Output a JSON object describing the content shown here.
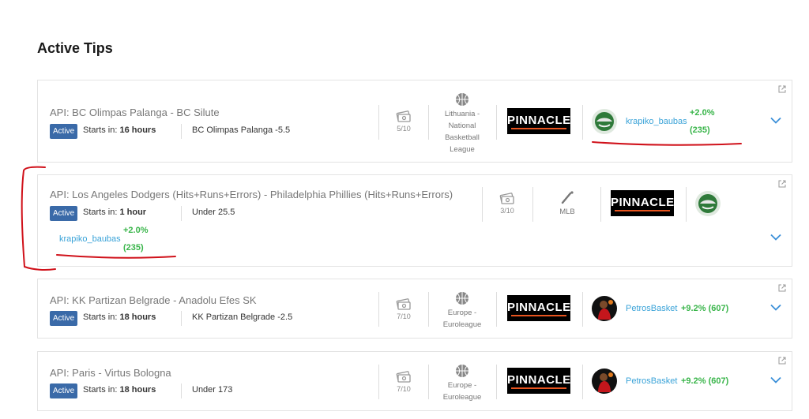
{
  "page": {
    "title": "Active Tips"
  },
  "colors": {
    "badge": "#3a6aa8",
    "tipster_link": "#3aa3d8",
    "roi_positive": "#39b54a",
    "bookmaker_bg": "#000000",
    "annotation": "#d0111a"
  },
  "tips": [
    {
      "title": "API: BC Olimpas Palanga - BC Silute",
      "status": "Active",
      "starts_label": "Starts in:",
      "starts_value": "16 hours",
      "pick": "BC Olimpas Palanga -5.5",
      "stake": "5/10",
      "sport_icon": "basketball-icon",
      "league": "Lithuania - National Basketball League",
      "bookmaker": "PINNACLE",
      "tipster": "krapiko_baubas",
      "roi": "+2.0%",
      "tips_count": "(235)"
    },
    {
      "title": "API: Los Angeles Dodgers (Hits+Runs+Errors) - Philadelphia Phillies (Hits+Runs+Errors)",
      "status": "Active",
      "starts_label": "Starts in:",
      "starts_value": "1 hour",
      "pick": "Under 25.5",
      "stake": "3/10",
      "sport_icon": "baseball-bat-icon",
      "league": "MLB",
      "bookmaker": "PINNACLE",
      "tipster": "krapiko_baubas",
      "roi": "+2.0%",
      "tips_count": "(235)"
    },
    {
      "title": "API: KK Partizan Belgrade - Anadolu Efes SK",
      "status": "Active",
      "starts_label": "Starts in:",
      "starts_value": "18 hours",
      "pick": "KK Partizan Belgrade -2.5",
      "stake": "7/10",
      "sport_icon": "basketball-icon",
      "league": "Europe - Euroleague",
      "bookmaker": "PINNACLE",
      "tipster": "PetrosBasket",
      "roi": "+9.2%",
      "tips_count": "(607)"
    },
    {
      "title": "API: Paris - Virtus Bologna",
      "status": "Active",
      "starts_label": "Starts in:",
      "starts_value": "18 hours",
      "pick": "Under 173",
      "stake": "7/10",
      "sport_icon": "basketball-icon",
      "league": "Europe - Euroleague",
      "bookmaker": "PINNACLE",
      "tipster": "PetrosBasket",
      "roi": "+9.2%",
      "tips_count": "(607)"
    }
  ]
}
